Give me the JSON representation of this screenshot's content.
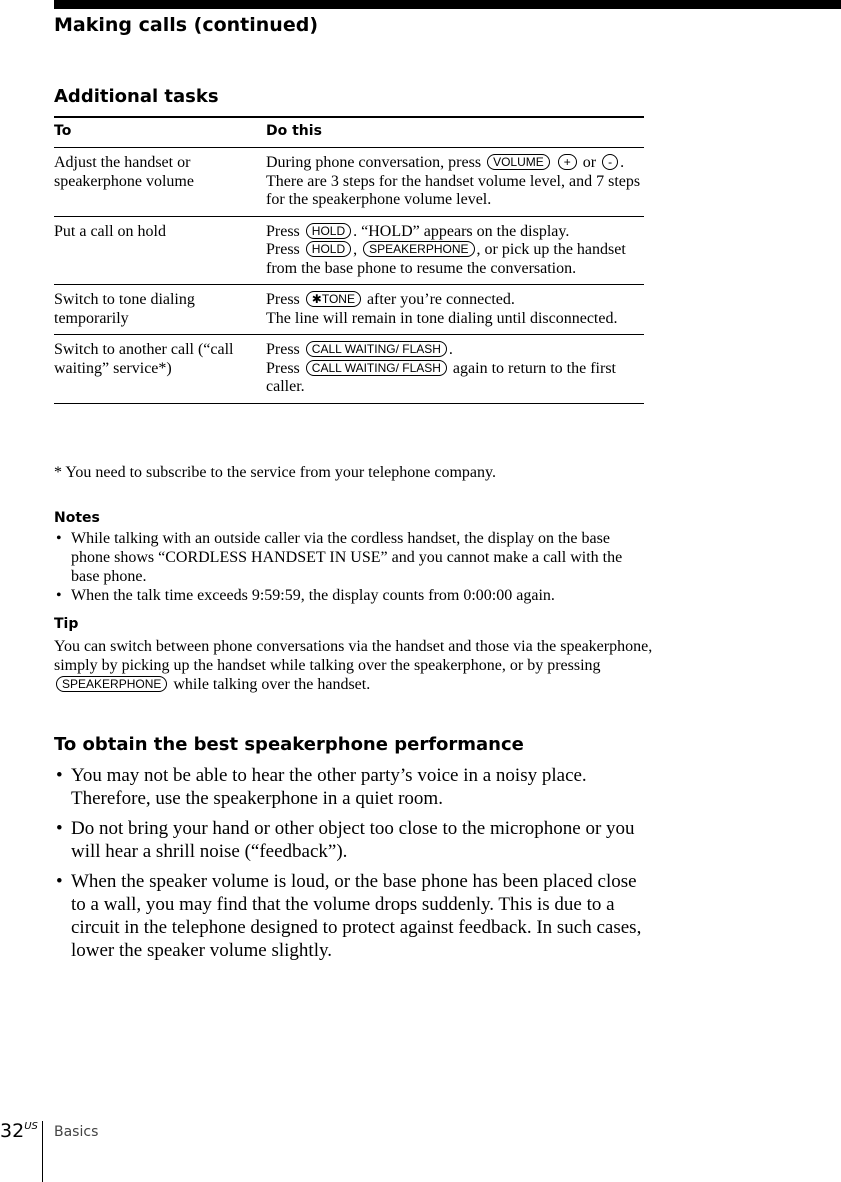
{
  "header": {
    "page_title": "Making calls (continued)"
  },
  "additional_tasks": {
    "title": "Additional tasks",
    "columns": [
      "To",
      "Do this"
    ],
    "rows": [
      {
        "to": "Adjust the handset or speakerphone volume",
        "do": [
          {
            "t": "text",
            "v": "During phone conversation, press "
          },
          {
            "t": "key",
            "v": "VOLUME"
          },
          {
            "t": "text",
            "v": " "
          },
          {
            "t": "key",
            "v": "+"
          },
          {
            "t": "text",
            "v": " or "
          },
          {
            "t": "key",
            "v": "-"
          },
          {
            "t": "text",
            "v": "."
          },
          {
            "t": "br"
          },
          {
            "t": "text",
            "v": "There are 3 steps for the handset volume level, and 7 steps for the speakerphone volume level."
          }
        ]
      },
      {
        "to": "Put a call on hold",
        "do": [
          {
            "t": "text",
            "v": "Press "
          },
          {
            "t": "key",
            "v": "HOLD"
          },
          {
            "t": "text",
            "v": ". “HOLD” appears on the display."
          },
          {
            "t": "br"
          },
          {
            "t": "text",
            "v": "Press "
          },
          {
            "t": "key",
            "v": "HOLD"
          },
          {
            "t": "text",
            "v": ", "
          },
          {
            "t": "key",
            "v": "SPEAKERPHONE"
          },
          {
            "t": "text",
            "v": ", or pick up the handset from the base phone to resume the conversation."
          }
        ]
      },
      {
        "to": "Switch to tone dialing temporarily",
        "do": [
          {
            "t": "text",
            "v": "Press "
          },
          {
            "t": "key",
            "v": "✱TONE"
          },
          {
            "t": "text",
            "v": " after you’re connected."
          },
          {
            "t": "br"
          },
          {
            "t": "text",
            "v": "The line will remain in tone dialing until disconnected."
          }
        ]
      },
      {
        "to": "Switch to another call (“call waiting” service*)",
        "do": [
          {
            "t": "text",
            "v": "Press "
          },
          {
            "t": "key",
            "v": "CALL WAITING/ FLASH"
          },
          {
            "t": "text",
            "v": "."
          },
          {
            "t": "br"
          },
          {
            "t": "text",
            "v": "Press "
          },
          {
            "t": "key",
            "v": "CALL WAITING/ FLASH"
          },
          {
            "t": "text",
            "v": " again to return to the first caller."
          }
        ]
      }
    ],
    "footnote": "*  You need to subscribe to the service from your telephone company."
  },
  "notes": {
    "heading": "Notes",
    "bullet": "•",
    "items": [
      "While talking with an outside caller via the cordless handset, the display on the base phone shows “CORDLESS  HANDSET  IN USE” and you cannot make a call with the base phone.",
      "When the talk time exceeds 9:59:59, the display counts from 0:00:00 again."
    ]
  },
  "tip": {
    "heading": "Tip",
    "body_before": "You can switch between phone conversations via the handset and those via the speakerphone, simply by picking up the handset while talking over the speakerphone, or by pressing ",
    "key": "SPEAKERPHONE",
    "body_after": " while talking over the handset."
  },
  "performance": {
    "title": "To obtain the best speakerphone performance",
    "bullet": "•",
    "items": [
      "You may not be able to hear the other party’s voice in a noisy place. Therefore, use the speakerphone in a quiet room.",
      "Do not bring your hand or other object too close to the microphone or you will hear a shrill noise (“feedback”).",
      "When the speaker volume is loud, or the base phone has been placed close to a wall, you may find that the volume drops suddenly.  This is due to a circuit in the telephone designed to protect against feedback.  In such cases, lower the speaker volume slightly."
    ]
  },
  "footer": {
    "page_number": "32",
    "page_suffix": "US",
    "section": "Basics"
  }
}
